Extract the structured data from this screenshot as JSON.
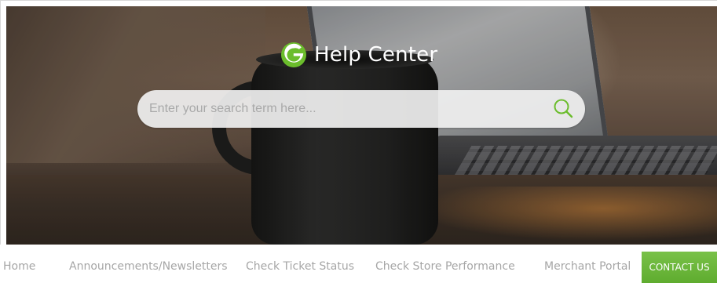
{
  "brand": {
    "logo_icon": "groupon-g-logo-icon",
    "title": "Help Center",
    "accent_color": "#6bbd2c"
  },
  "search": {
    "placeholder": "Enter your search term here...",
    "value": "",
    "icon": "search-icon"
  },
  "nav": {
    "items": [
      {
        "label": "Home"
      },
      {
        "label": "Announcements/Newsletters"
      },
      {
        "label": "Check Ticket Status"
      },
      {
        "label": "Check Store Performance"
      },
      {
        "label": "Merchant Portal"
      }
    ],
    "contact_label": "CONTACT US",
    "contact_color": "#6bb53a",
    "text_color": "#a6a6a6"
  }
}
